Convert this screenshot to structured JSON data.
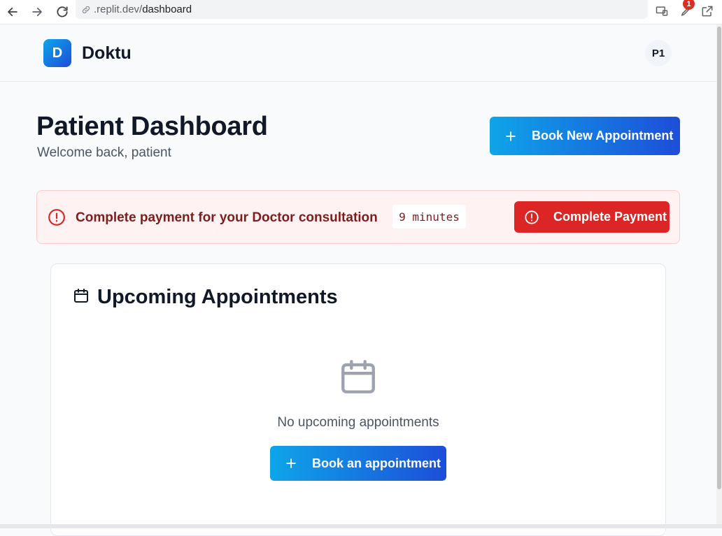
{
  "browser": {
    "url_domain": ".replit.dev/",
    "url_path": "dashboard",
    "notification_count": "1"
  },
  "header": {
    "logo_letter": "D",
    "brand_name": "Doktu",
    "avatar_initials": "P1"
  },
  "page": {
    "title": "Patient Dashboard",
    "subtitle": "Welcome back, patient",
    "book_button_label": "Book New Appointment"
  },
  "alert": {
    "message": "Complete payment for your Doctor consultation",
    "timer": "9 minutes",
    "button_label": "Complete Payment"
  },
  "appointments": {
    "title": "Upcoming Appointments",
    "empty_text": "No upcoming appointments",
    "book_button_label": "Book an appointment"
  },
  "colors": {
    "primary_start": "#0ea5e9",
    "primary_end": "#1d4ed8",
    "danger": "#dc2626",
    "alert_bg": "#fef2f2",
    "alert_text": "#7f1d1d"
  },
  "icons": [
    "back-arrow-icon",
    "forward-arrow-icon",
    "reload-icon",
    "link-icon",
    "cast-icon",
    "extension-icon",
    "open-external-icon",
    "plus-icon",
    "alert-circle-icon",
    "calendar-icon"
  ]
}
